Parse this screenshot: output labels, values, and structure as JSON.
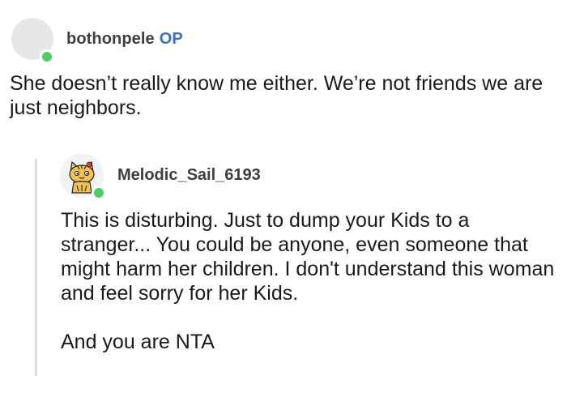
{
  "comment": {
    "username": "bothonpele",
    "badge": "OP",
    "body": "She doesn’t really know me either. We’re not friends we are just neighbors."
  },
  "reply": {
    "username": "Melodic_Sail_6193",
    "paragraphs": [
      "This is disturbing. Just to dump your Kids to a stranger... You could be anyone, even someone that might harm her children. I don't understand this woman and feel sorry for her Kids.",
      "And you are NTA"
    ]
  },
  "colors": {
    "online": "#46d160",
    "op_badge": "#3a6fcf",
    "thread_line": "#e0e0e0"
  },
  "icons": {
    "top_avatar": "default-avatar-icon",
    "reply_avatar": "snoo-avatar-icon",
    "status": "online-status-icon"
  }
}
